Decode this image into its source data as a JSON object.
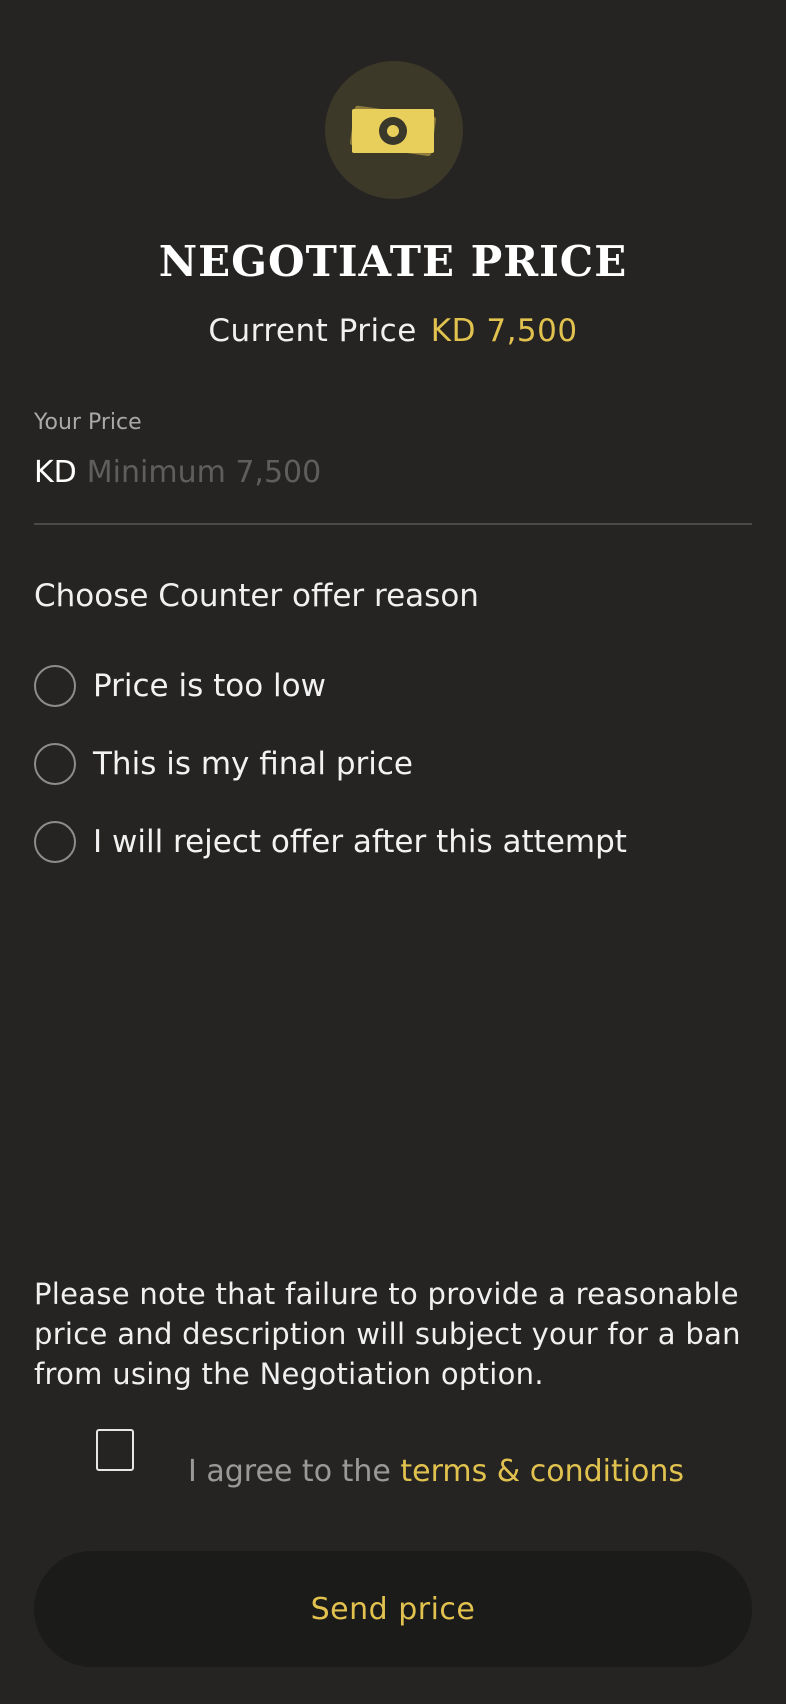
{
  "header": {
    "icon": "money-icon",
    "title": "NEGOTIATE PRICE",
    "current_price_label": "Current Price",
    "current_price_value": "KD 7,500"
  },
  "price_input": {
    "label": "Your Price",
    "currency": "KD",
    "value": "",
    "placeholder": "Minimum 7,500"
  },
  "reasons": {
    "heading": "Choose Counter offer reason",
    "options": [
      {
        "label": "Price is too low",
        "selected": false
      },
      {
        "label": "This is my final price",
        "selected": false
      },
      {
        "label": "I will reject offer after this attempt",
        "selected": false
      }
    ]
  },
  "note": "Please note that failure to provide a reasonable price and description will subject your for a ban from using the Negotiation option.",
  "agreement": {
    "checked": false,
    "prefix": "I agree to the",
    "link": "terms & conditions"
  },
  "send_button_label": "Send price",
  "colors": {
    "background": "#252423",
    "accent": "#e2c24e",
    "button_background": "#1b1b1a"
  }
}
